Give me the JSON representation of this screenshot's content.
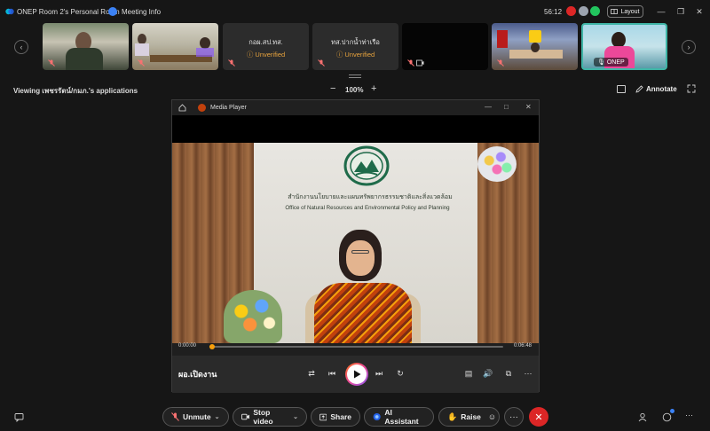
{
  "titlebar": {
    "app_title": "ONEP Room 2's Personal Room",
    "meeting_info": "Meeting Info",
    "time": "56:12",
    "layout_label": "Layout",
    "status_colors": [
      "#dc2626",
      "#9ca3af",
      "#22c55e"
    ]
  },
  "filmstrip": {
    "tiles": [
      {
        "type": "video",
        "scene": "man-office"
      },
      {
        "type": "video",
        "scene": "meeting-room"
      },
      {
        "type": "name",
        "name": "กอผ.สป.ทส.",
        "status": "Unverified"
      },
      {
        "type": "name",
        "name": "ทส.ปากน้ำท่าเรือ",
        "status": "Unverified"
      },
      {
        "type": "blank"
      },
      {
        "type": "video",
        "scene": "conference"
      },
      {
        "type": "video",
        "scene": "woman-pink",
        "badge": "ONEP"
      }
    ]
  },
  "share_bar": {
    "viewing": "Viewing เพชรรัตน์/กมภ.'s applications",
    "zoom": "100%",
    "annotate": "Annotate"
  },
  "player": {
    "title": "Media Player",
    "video_heading_th": "สำนักงานนโยบายและแผนทรัพยากรธรรมชาติและสิ่งแวดล้อม",
    "video_heading_en": "Office of Natural Resources and Environmental Policy and Planning",
    "time_current": "0:00:00",
    "time_total": "0:06:48",
    "progress": 0.01,
    "media_title": "ผอ.เปิดงาน"
  },
  "bottombar": {
    "unmute": "Unmute",
    "stop_video": "Stop video",
    "share": "Share",
    "ai_assistant": "AI Assistant",
    "raise": "Raise",
    "more": "···"
  },
  "colors": {
    "accent": "#3b82f6",
    "warning": "#e8a33d",
    "danger": "#dc2626"
  }
}
